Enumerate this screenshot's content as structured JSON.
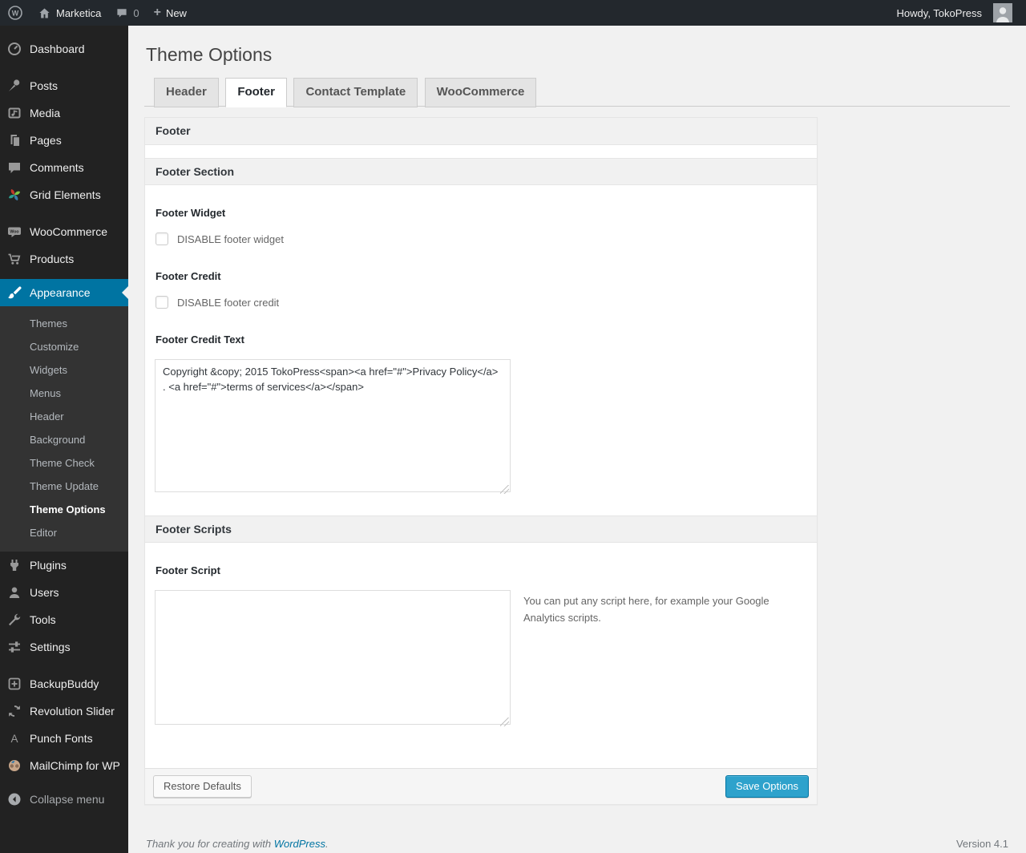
{
  "admin_bar": {
    "site_name": "Marketica",
    "comment_count": "0",
    "new_label": "New",
    "howdy": "Howdy, TokoPress"
  },
  "sidebar": {
    "items": [
      {
        "id": "dashboard",
        "label": "Dashboard"
      },
      {
        "id": "posts",
        "label": "Posts"
      },
      {
        "id": "media",
        "label": "Media"
      },
      {
        "id": "pages",
        "label": "Pages"
      },
      {
        "id": "comments",
        "label": "Comments"
      },
      {
        "id": "grid-elements",
        "label": "Grid Elements"
      },
      {
        "id": "woocommerce",
        "label": "WooCommerce"
      },
      {
        "id": "products",
        "label": "Products"
      },
      {
        "id": "appearance",
        "label": "Appearance"
      },
      {
        "id": "plugins",
        "label": "Plugins"
      },
      {
        "id": "users",
        "label": "Users"
      },
      {
        "id": "tools",
        "label": "Tools"
      },
      {
        "id": "settings",
        "label": "Settings"
      },
      {
        "id": "backupbuddy",
        "label": "BackupBuddy"
      },
      {
        "id": "revolution-slider",
        "label": "Revolution Slider"
      },
      {
        "id": "punch-fonts",
        "label": "Punch Fonts"
      },
      {
        "id": "mailchimp",
        "label": "MailChimp for WP"
      },
      {
        "id": "collapse",
        "label": "Collapse menu"
      }
    ],
    "appearance_submenu": [
      "Themes",
      "Customize",
      "Widgets",
      "Menus",
      "Header",
      "Background",
      "Theme Check",
      "Theme Update",
      "Theme Options",
      "Editor"
    ],
    "current_submenu_item": "Theme Options"
  },
  "page": {
    "title": "Theme Options",
    "tabs": [
      {
        "label": "Header",
        "active": false
      },
      {
        "label": "Footer",
        "active": true
      },
      {
        "label": "Contact Template",
        "active": false
      },
      {
        "label": "WooCommerce",
        "active": false
      }
    ]
  },
  "panel": {
    "box_title": "Footer",
    "footer_section_title": "Footer Section",
    "footer_widget_label": "Footer Widget",
    "footer_widget_checkbox": "DISABLE footer widget",
    "footer_credit_label": "Footer Credit",
    "footer_credit_checkbox": "DISABLE footer credit",
    "footer_credit_text_label": "Footer Credit Text",
    "footer_credit_text_value": "Copyright &copy; 2015 TokoPress<span><a href=\"#\">Privacy Policy</a> . <a href=\"#\">terms of services</a></span>",
    "footer_scripts_title": "Footer Scripts",
    "footer_script_label": "Footer Script",
    "footer_script_value": "",
    "footer_script_help": "You can put any script here, for example your Google Analytics scripts.",
    "restore_button": "Restore Defaults",
    "save_button": "Save Options"
  },
  "page_footer": {
    "thanks_prefix": "Thank you for creating with ",
    "wordpress_link": "WordPress",
    "thanks_suffix": ".",
    "version": "Version 4.1"
  },
  "colors": {
    "accent": "#0074a2",
    "primary_button": "#2ea2cc",
    "menu_background": "#222222",
    "submenu_background": "#333333",
    "page_background": "#f1f1f1"
  }
}
